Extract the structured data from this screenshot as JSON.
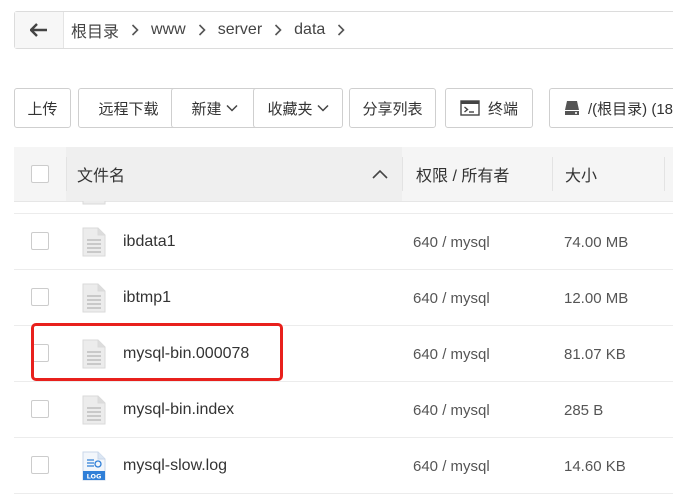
{
  "breadcrumb": {
    "back_icon": "arrow-left-icon",
    "items": [
      "根目录",
      "www",
      "server",
      "data"
    ]
  },
  "toolbar": {
    "upload": "上传",
    "remote_download": "远程下载",
    "new": "新建",
    "favorites": "收藏夹",
    "share_list": "分享列表",
    "terminal": "终端",
    "disk": "/(根目录) (18"
  },
  "table": {
    "columns": {
      "name": "文件名",
      "permission": "权限 / 所有者",
      "size": "大小"
    },
    "sort_icon": "chevron-up-icon",
    "rows": [
      {
        "name": "ibdata1",
        "permission": "640 / mysql",
        "size": "74.00 MB",
        "icon": "file-icon"
      },
      {
        "name": "ibtmp1",
        "permission": "640 / mysql",
        "size": "12.00 MB",
        "icon": "file-icon"
      },
      {
        "name": "mysql-bin.000078",
        "permission": "640 / mysql",
        "size": "81.07 KB",
        "icon": "file-icon"
      },
      {
        "name": "mysql-bin.index",
        "permission": "640 / mysql",
        "size": "285 B",
        "icon": "file-icon"
      },
      {
        "name": "mysql-slow.log",
        "permission": "640 / mysql",
        "size": "14.60 KB",
        "icon": "log-file-icon",
        "icon_label": "LOG"
      }
    ]
  },
  "colors": {
    "highlight": "#e8201c",
    "log_icon": "#2f7fd8"
  }
}
